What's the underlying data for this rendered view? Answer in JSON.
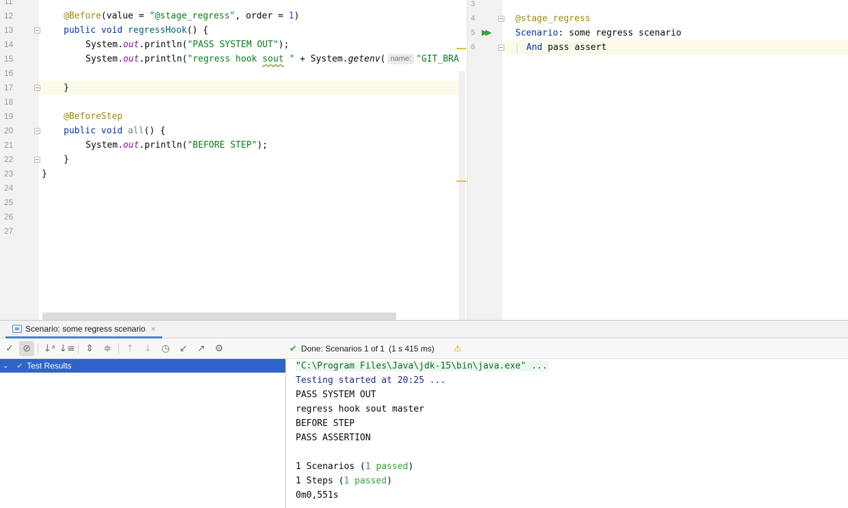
{
  "left_editor": {
    "line_numbers": [
      "11",
      "12",
      "13",
      "14",
      "15",
      "16",
      "17",
      "18",
      "19",
      "20",
      "21",
      "22",
      "23",
      "24",
      "25",
      "26",
      "27"
    ],
    "l12": {
      "anno": "@Before",
      "p1": "(value = ",
      "str": "\"@stage_regress\"",
      "p2": ", order = ",
      "num": "1",
      "p3": ")"
    },
    "l13": {
      "kw": "public void ",
      "fn": "regressHook",
      "rest": "() {"
    },
    "l14": {
      "p1": "System.",
      "field": "out",
      "p2": ".println(",
      "str": "\"PASS SYSTEM OUT\"",
      "p3": ");"
    },
    "l15": {
      "p1": "System.",
      "field": "out",
      "p2": ".println(",
      "str1": "\"regress hook ",
      "str_u": "sout",
      "str2": " \"",
      "p3": " + System.",
      "call": "getenv",
      "p4": "(",
      "hint": "name:",
      "str3": "\"GIT_BRA"
    },
    "l17": {
      "rest": "}"
    },
    "l19": {
      "anno": "@BeforeStep"
    },
    "l20": {
      "kw": "public void ",
      "fn": "all",
      "rest": "() {"
    },
    "l21": {
      "p1": "System.",
      "field": "out",
      "p2": ".println(",
      "str": "\"BEFORE STEP\"",
      "p3": ");"
    },
    "l22": {
      "rest": "}"
    },
    "l23": {
      "rest": "}"
    }
  },
  "right_editor": {
    "line_numbers": [
      "3",
      "4",
      "5",
      "6"
    ],
    "tag": "@stage_regress",
    "scenario_kw": "Scenario",
    "scenario_rest": ": some regress scenario",
    "step_kw": "And",
    "step_rest": " pass assert",
    "run_icon": "run-double-arrow-icon"
  },
  "run_window": {
    "tab_label": "Scenario: some regress scenario",
    "tab_close": "×",
    "status_text": "Done: Scenarios 1 of 1",
    "status_time": "(1 s 415 ms)",
    "toolbar_icons": [
      "check-icon",
      "stop-icon",
      "sort-alpha-icon",
      "sort-duration-icon",
      "expand-all-icon",
      "collapse-all-icon",
      "up-arrow-icon",
      "down-arrow-icon",
      "history-icon",
      "import-icon",
      "export-icon",
      "settings-icon"
    ],
    "tree": {
      "chevron": "⌄",
      "check": "✔",
      "label": "Test Results"
    }
  },
  "console": {
    "cmd": "\"C:\\Program Files\\Java\\jdk-15\\bin\\java.exe\" ...",
    "started": "Testing started at 20:25 ...",
    "out1": "PASS SYSTEM OUT",
    "out2": "regress hook sout master",
    "out3": "BEFORE STEP",
    "out4": "PASS ASSERTION",
    "sum1_a": "1 Scenarios (",
    "sum1_b": "1 passed",
    "sum1_c": ")",
    "sum2_a": "1 Steps (",
    "sum2_b": "1 passed",
    "sum2_c": ")",
    "time": "0m0,551s"
  },
  "colors": {
    "selection": "#2f65ca",
    "passed_green": "#2aa534",
    "tab_underline": "#4083c9",
    "annotation": "#9e880d",
    "keyword": "#0033b3",
    "string": "#067d17"
  }
}
